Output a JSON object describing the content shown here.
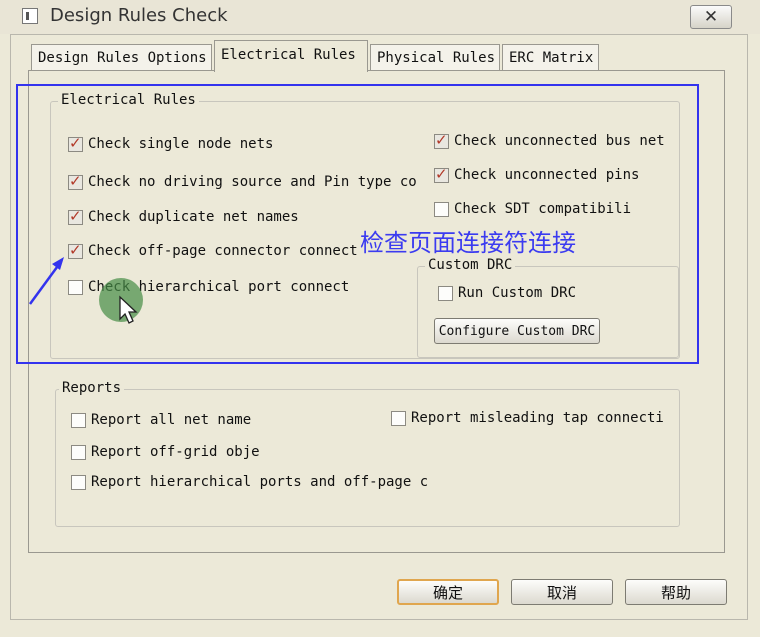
{
  "window": {
    "title": "Design Rules Check",
    "close_glyph": "✕"
  },
  "tabs": [
    {
      "label": "Design Rules Options",
      "active": false
    },
    {
      "label": "Electrical Rules",
      "active": true
    },
    {
      "label": "Physical Rules",
      "active": false
    },
    {
      "label": "ERC Matrix",
      "active": false
    }
  ],
  "electrical_rules": {
    "legend": "Electrical Rules",
    "left_items": [
      {
        "label": "Check single node nets",
        "checked": true
      },
      {
        "label": "Check no driving source and Pin type co",
        "checked": true
      },
      {
        "label": "Check duplicate net names",
        "checked": true
      },
      {
        "label": "Check off-page connector connect",
        "checked": true
      },
      {
        "label": "Check hierarchical port connect",
        "checked": false
      }
    ],
    "right_items": [
      {
        "label": "Check unconnected bus net",
        "checked": true
      },
      {
        "label": "Check unconnected pins",
        "checked": true
      },
      {
        "label": "Check SDT compatibili",
        "checked": false
      }
    ],
    "custom_drc": {
      "legend": "Custom DRC",
      "run_label": "Run Custom DRC",
      "run_checked": false,
      "configure_label": "Configure Custom DRC"
    }
  },
  "reports": {
    "legend": "Reports",
    "items": [
      {
        "label": "Report all net name",
        "checked": false
      },
      {
        "label": "Report misleading tap connecti",
        "checked": false
      },
      {
        "label": "Report off-grid obje",
        "checked": false
      },
      {
        "label": "Report hierarchical ports and off-page c",
        "checked": false
      }
    ]
  },
  "buttons": {
    "ok": "确定",
    "cancel": "取消",
    "help": "帮助"
  },
  "annotation": {
    "text": "检查页面连接符连接",
    "color": "#3b3bf0"
  },
  "colors": {
    "background": "#ece9d8",
    "checkmark": "#b23a2a",
    "default_button_border": "#e0a64e",
    "annotation": "#3333ee"
  }
}
